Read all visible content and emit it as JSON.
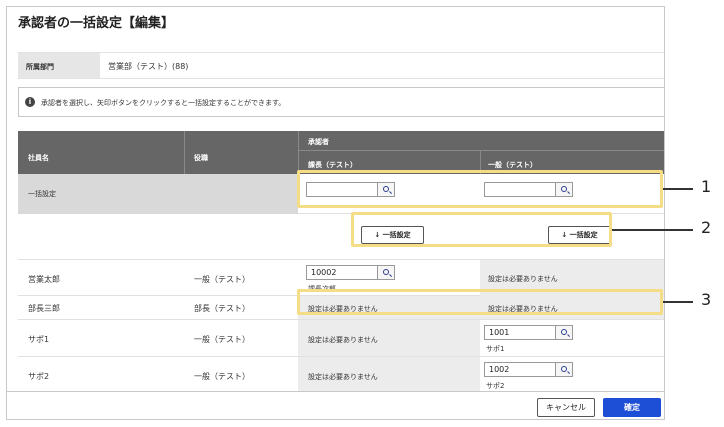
{
  "dialog": {
    "title": "承認者の一括設定【編集】"
  },
  "department": {
    "label": "所属部門",
    "value": "営業部（テスト）(88)"
  },
  "info": {
    "icon": "info-icon",
    "text": "承認者を選択し、矢印ボタンをクリックすると一括設定することができます。"
  },
  "table": {
    "col_name": "社員名",
    "col_role": "役職",
    "col_approver": "承認者",
    "col_manager": "課長（テスト）",
    "col_general": "一般（テスト）",
    "bulk_row_label": "一括設定",
    "bulk_button_label": "↓ 一括設定",
    "rows": [
      {
        "name": "営業太郎",
        "role": "一般（テスト）",
        "manager_value": "10002",
        "manager_sub": "課長次郎",
        "general_text": "設定は必要ありません"
      },
      {
        "name": "部長三郎",
        "role": "部長（テスト）",
        "manager_text": "設定は必要ありません",
        "general_text": "設定は必要ありません"
      },
      {
        "name": "サポ1",
        "role": "一般（テスト）",
        "manager_text": "設定は必要ありません",
        "general_value": "1001",
        "general_sub": "サポ1"
      },
      {
        "name": "サポ2",
        "role": "一般（テスト）",
        "manager_text": "設定は必要ありません",
        "general_value": "1002",
        "general_sub": "サポ2"
      }
    ]
  },
  "footer": {
    "cancel_label": "キャンセル",
    "ok_label": "確定"
  },
  "callouts": [
    "1",
    "2",
    "3"
  ],
  "colors": {
    "accent": "#1d4fd6",
    "highlight": "#f5dd85",
    "header": "#666666"
  }
}
